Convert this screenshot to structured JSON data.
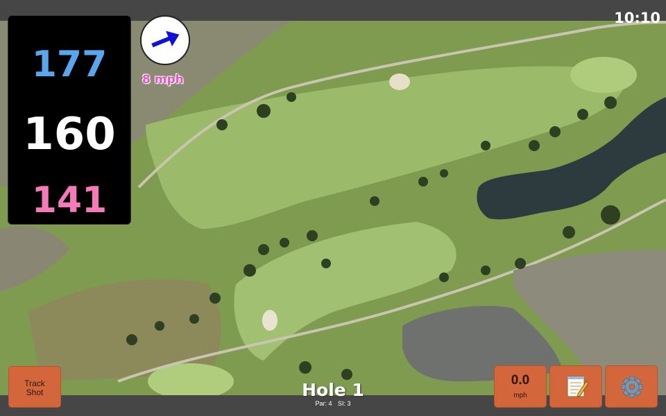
{
  "status": {
    "time": "10:10"
  },
  "yardage": {
    "back": "177",
    "center": "160",
    "front": "141"
  },
  "wind": {
    "speed": "8 mph",
    "direction_icon": "wind-arrow-icon"
  },
  "hole": {
    "title": "Hole 1",
    "par": "Par: 4",
    "si": "SI: 3"
  },
  "buttons": {
    "track_shot": [
      "Track",
      "Shot"
    ],
    "speed_value": "0.0",
    "speed_unit": "mph",
    "notes_icon": "notepad-icon",
    "settings_icon": "gear-icon"
  },
  "colors": {
    "back": "#5aa6ec",
    "center": "#ffffff",
    "front": "#f47ab8",
    "wind": "#e058c0",
    "button": "#d4663c",
    "fairway": "#9cbb6a",
    "rough": "#7f9b50",
    "water": "#2d3a3e"
  }
}
